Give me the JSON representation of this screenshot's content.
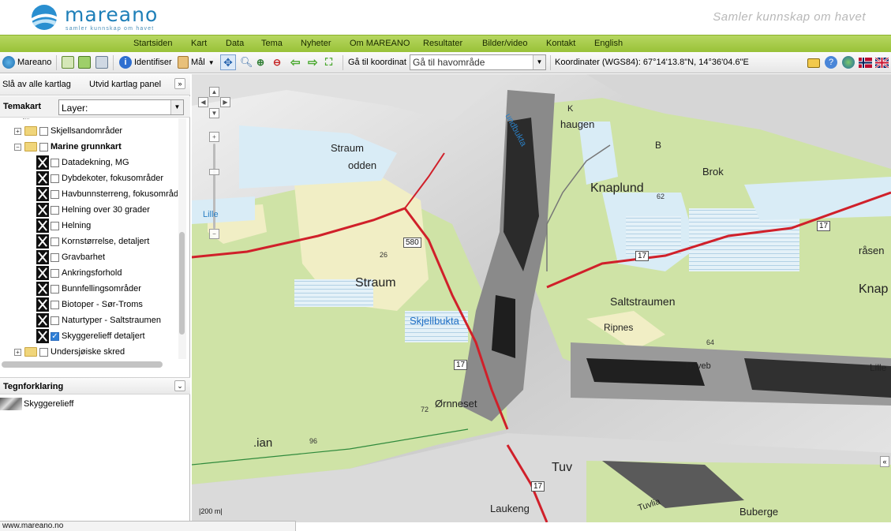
{
  "header": {
    "brand": "mareano",
    "brand_sub": "samler kunnskap om havet",
    "tagline": "Samler kunnskap om havet"
  },
  "nav": [
    "Startsiden",
    "Kart",
    "Data",
    "Tema",
    "Nyheter",
    "Om MAREANO",
    "Resultater",
    "Bilder/video",
    "Kontakt",
    "English"
  ],
  "toolbar": {
    "home_label": "Mareano",
    "identify_label": "Identifiser",
    "measure_label": "Mål",
    "goto_label": "Gå til koordinat",
    "area_select_value": "Gå til havområde",
    "coordinates_label": "Koordinater (WGS84): 67°14'13.8\"N, 14°36'04.6\"E"
  },
  "panel": {
    "toggle_all": "Slå av alle kartlag",
    "expand_panel": "Utvid kartlag panel",
    "tema_label": "Temakart",
    "layer_select_value": "Layer:",
    "tree": [
      {
        "label": "Skjellsandområder",
        "type": "folder",
        "expanded": false,
        "checked": false,
        "bold": false
      },
      {
        "label": "Marine grunnkart",
        "type": "folder",
        "expanded": true,
        "checked": false,
        "bold": true
      },
      {
        "label": "Datadekning, MG",
        "type": "layer",
        "checked": false
      },
      {
        "label": "Dybdekoter, fokusområder",
        "type": "layer",
        "checked": false
      },
      {
        "label": "Havbunnsterreng, fokusområder",
        "type": "layer",
        "checked": false
      },
      {
        "label": "Helning over 30 grader",
        "type": "layer",
        "checked": false
      },
      {
        "label": "Helning",
        "type": "layer",
        "checked": false
      },
      {
        "label": "Kornstørrelse, detaljert",
        "type": "layer",
        "checked": false
      },
      {
        "label": "Gravbarhet",
        "type": "layer",
        "checked": false
      },
      {
        "label": "Ankringsforhold",
        "type": "layer",
        "checked": false
      },
      {
        "label": "Bunnfellingsområder",
        "type": "layer",
        "checked": false
      },
      {
        "label": "Biotoper - Sør-Troms",
        "type": "layer",
        "checked": false
      },
      {
        "label": "Naturtyper - Saltstraumen",
        "type": "layer",
        "checked": false
      },
      {
        "label": "Skyggerelieff detaljert",
        "type": "layer",
        "checked": true
      },
      {
        "label": "Undersjøiske skred",
        "type": "folder",
        "expanded": false,
        "checked": false,
        "bold": false
      }
    ],
    "legend_title": "Tegnforklaring",
    "legend_item": "Skyggerelieff"
  },
  "map": {
    "labels": {
      "straum": "Straum",
      "straumodden_1": "Straum",
      "straumodden_2": "odden",
      "knaplund": "Knaplund",
      "saltstraumen": "Saltstraumen",
      "skjellbukta": "Skjellbukta",
      "ripnes": "Ripnes",
      "ornneset": "Ørnneset",
      "ian": ".ian",
      "haugen": "haugen",
      "laukeng": "Laukeng",
      "buberge": "Buberge",
      "tuvlia": "Tuvlia",
      "tuv": "Tuv",
      "rasen": "råsen",
      "knap": "Knap",
      "lille_right": "Lille",
      "lille_left": "Lille",
      "brok": "Brok",
      "b": "B",
      "haveb": "Haveb",
      "sundbukta": "undbukta",
      "k_top": "K"
    },
    "roads": {
      "r17a": "17",
      "r17b": "17",
      "r17c": "17",
      "r17d": "17",
      "r580": "580"
    },
    "elevations": {
      "e26": "26",
      "e62": "62",
      "e64": "64",
      "e72": "72",
      "e96": "96"
    },
    "scale": "200 m"
  },
  "status": "www.mareano.no",
  "colors": {
    "nav_green": "#a9cf4f",
    "land": "#cfe3a6",
    "water": "#d9ecf6",
    "road": "#d0202a",
    "accent": "#1e7fb8"
  }
}
